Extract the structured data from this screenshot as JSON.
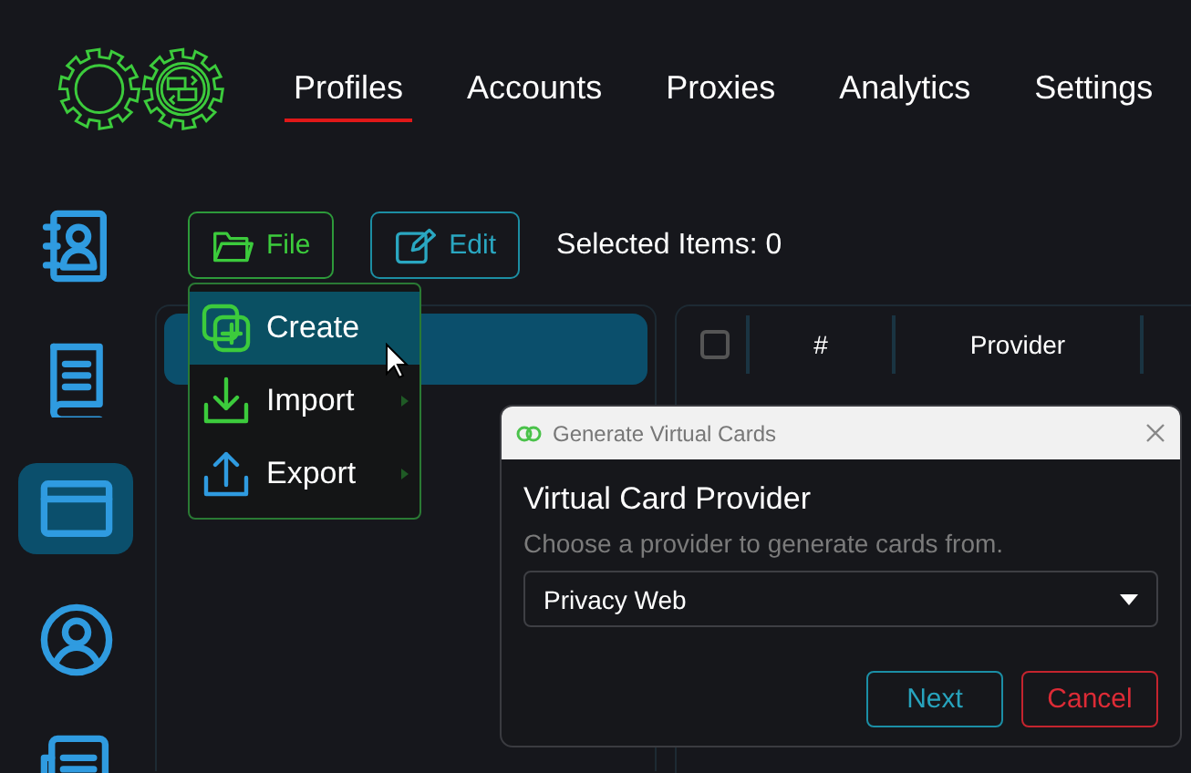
{
  "header": {
    "nav": [
      {
        "label": "Profiles",
        "selected": true
      },
      {
        "label": "Accounts",
        "selected": false
      },
      {
        "label": "Proxies",
        "selected": false
      },
      {
        "label": "Analytics",
        "selected": false
      },
      {
        "label": "Settings",
        "selected": false
      }
    ]
  },
  "sidebar": {
    "items": [
      {
        "kind": "contacts",
        "selected": false
      },
      {
        "kind": "book",
        "selected": false
      },
      {
        "kind": "card",
        "selected": true
      },
      {
        "kind": "user",
        "selected": false
      },
      {
        "kind": "news",
        "selected": false
      }
    ]
  },
  "toolbar": {
    "buttons": [
      {
        "kind": "file",
        "label": "File"
      },
      {
        "kind": "edit",
        "label": "Edit"
      }
    ],
    "selection": "Selected Items: 0"
  },
  "file_menu": {
    "items": [
      {
        "kind": "create",
        "label": "Create",
        "selected": true,
        "submenu": false
      },
      {
        "kind": "import",
        "label": "Import",
        "selected": false,
        "submenu": true
      },
      {
        "kind": "export",
        "label": "Export",
        "selected": false,
        "submenu": true
      }
    ]
  },
  "table": {
    "select_all": {
      "checked": false
    },
    "columns": [
      "#",
      "Provider"
    ]
  },
  "dialog": {
    "title": "Generate Virtual Cards",
    "heading": "Virtual Card Provider",
    "description": "Choose a provider to generate cards from.",
    "provider": {
      "value": "Privacy Web"
    },
    "buttons": [
      {
        "kind": "next",
        "label": "Next"
      },
      {
        "kind": "cancel",
        "label": "Cancel"
      }
    ]
  }
}
